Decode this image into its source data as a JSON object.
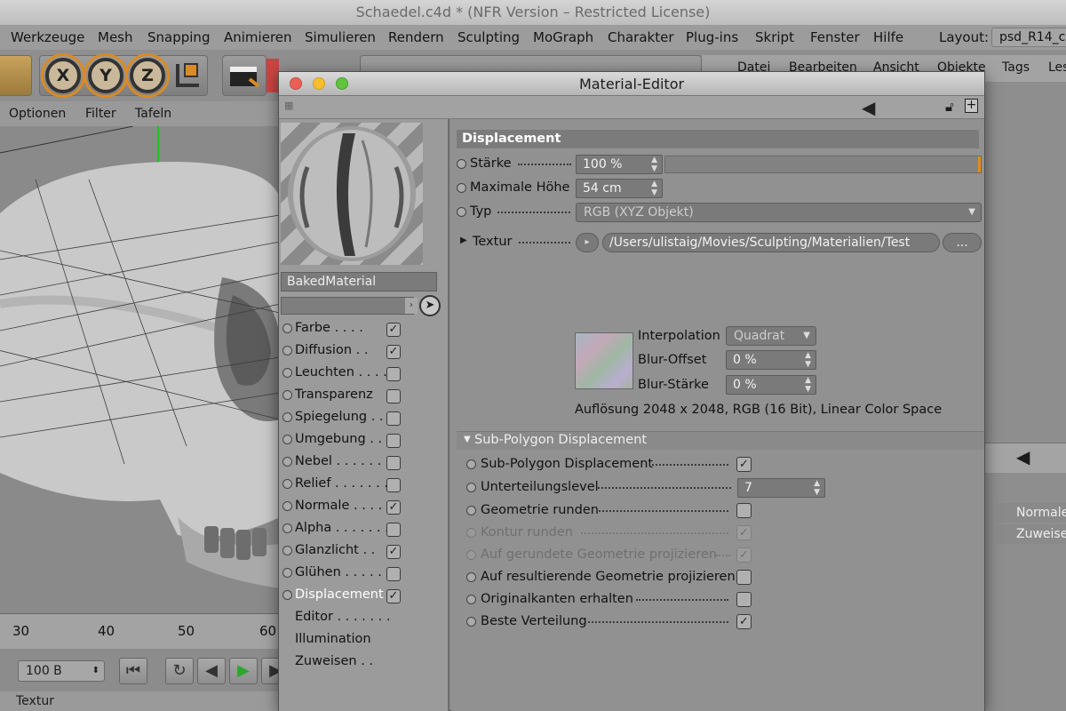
{
  "app": {
    "title": "Schaedel.c4d * (NFR Version – Restricted License)",
    "menu": [
      "Werkzeuge",
      "Mesh",
      "Snapping",
      "Animieren",
      "Simulieren",
      "Rendern",
      "Sculpting",
      "MoGraph",
      "Charakter",
      "Plug-ins",
      "Skript",
      "Fenster",
      "Hilfe"
    ],
    "layout_label": "Layout:",
    "layout_value": "psd_R14_c",
    "axes": [
      "X",
      "Y",
      "Z"
    ],
    "view_menu": [
      "Optionen",
      "Filter",
      "Tafeln"
    ],
    "right_menu": [
      "Datei",
      "Bearbeiten",
      "Ansicht",
      "Objekte",
      "Tags",
      "Les"
    ],
    "right_panel": [
      "Normale",
      "Zuweise"
    ],
    "timeline_ticks": [
      "30",
      "40",
      "50",
      "60"
    ],
    "frame_value": "100 B",
    "bottom_tab": "Textur",
    "accent_color": "#e0901e"
  },
  "editor": {
    "title": "Material-Editor",
    "material_name": "BakedMaterial",
    "channels": [
      {
        "label": "Farbe . . . .",
        "checked": true
      },
      {
        "label": "Diffusion . .",
        "checked": true
      },
      {
        "label": "Leuchten . . . .",
        "checked": false
      },
      {
        "label": "Transparenz",
        "checked": false
      },
      {
        "label": "Spiegelung . .",
        "checked": false
      },
      {
        "label": "Umgebung . .",
        "checked": false
      },
      {
        "label": "Nebel . . . . . . .",
        "checked": false
      },
      {
        "label": "Relief . . . . . . .",
        "checked": false
      },
      {
        "label": "Normale . . . .",
        "checked": true
      },
      {
        "label": "Alpha . . . . . . .",
        "checked": false
      },
      {
        "label": "Glanzlicht . .",
        "checked": true
      },
      {
        "label": "Glühen . . . . . .",
        "checked": false
      },
      {
        "label": "Displacement",
        "checked": true,
        "selected": true
      }
    ],
    "extra_items": [
      "Editor . . . . . . .",
      "Illumination",
      "Zuweisen . ."
    ],
    "section_title": "Displacement",
    "staerke": {
      "label": "Stärke",
      "value": "100 %",
      "level": 1.0
    },
    "max_hoehe": {
      "label": "Maximale Höhe",
      "value": "54 cm"
    },
    "typ": {
      "label": "Typ",
      "value": "RGB (XYZ Objekt)"
    },
    "textur": {
      "label": "Textur",
      "path": "/Users/ulistaig/Movies/Sculpting/Materialien/Test",
      "more": "..."
    },
    "interpolation": {
      "label": "Interpolation",
      "value": "Quadrat"
    },
    "blur_offset": {
      "label": "Blur-Offset",
      "value": "0 %"
    },
    "blur_staerke": {
      "label": "Blur-Stärke",
      "value": "0 %"
    },
    "aufloesung": "Auflösung 2048 x 2048, RGB (16 Bit), Linear Color Space",
    "subpoly": {
      "title": "Sub-Polygon Displacement",
      "rows": [
        {
          "label": "Sub-Polygon Displacement",
          "checked": true,
          "enabled": true
        },
        {
          "label": "Unterteilungslevel",
          "value": "7",
          "enabled": true
        },
        {
          "label": "Geometrie runden",
          "checked": false,
          "enabled": true
        },
        {
          "label": "Kontur runden",
          "checked": true,
          "enabled": false
        },
        {
          "label": "Auf gerundete Geometrie projizieren",
          "checked": true,
          "enabled": false
        },
        {
          "label": "Auf resultierende Geometrie projizieren",
          "checked": false,
          "enabled": true
        },
        {
          "label": "Originalkanten erhalten",
          "checked": false,
          "enabled": true
        },
        {
          "label": "Beste Verteilung",
          "checked": true,
          "enabled": true
        }
      ]
    }
  }
}
